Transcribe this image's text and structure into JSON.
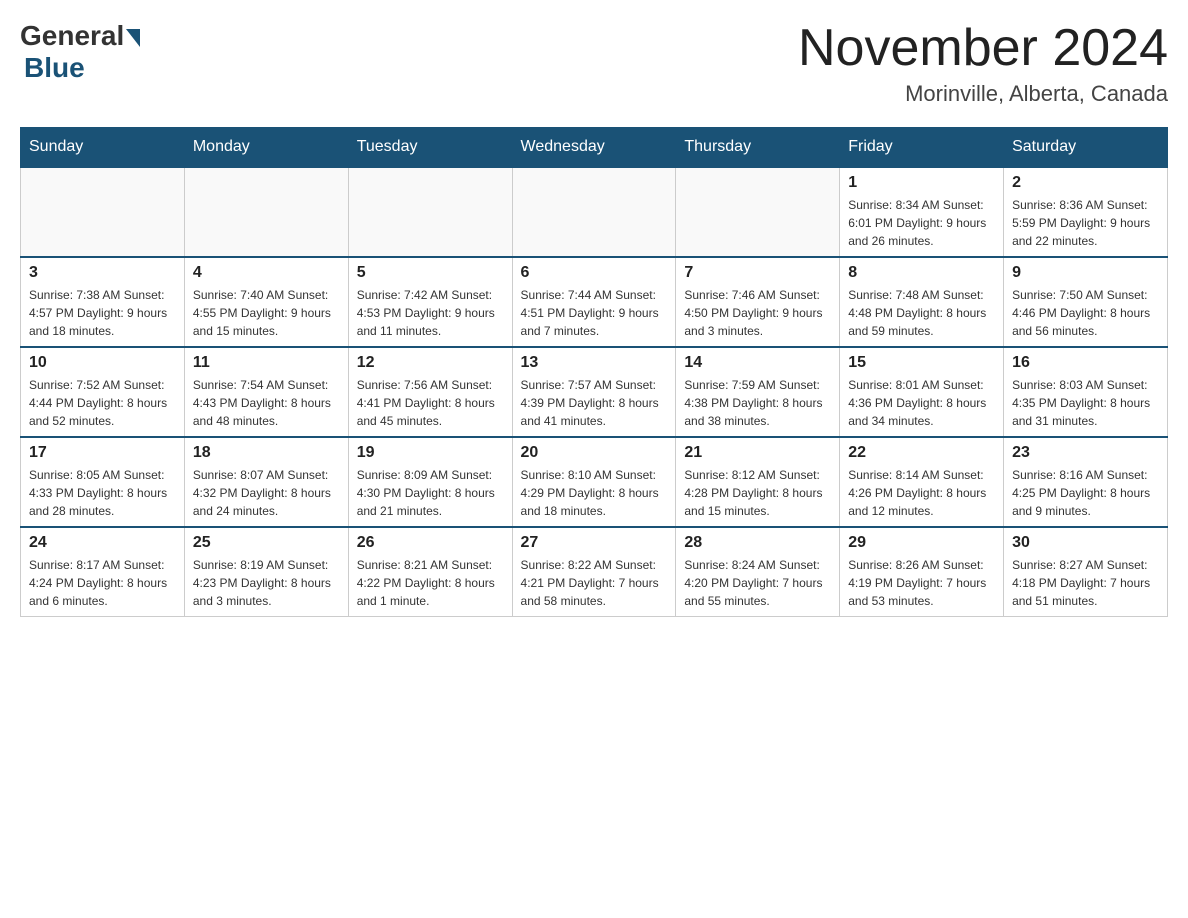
{
  "header": {
    "logo_general": "General",
    "logo_blue": "Blue",
    "main_title": "November 2024",
    "subtitle": "Morinville, Alberta, Canada"
  },
  "days_of_week": [
    "Sunday",
    "Monday",
    "Tuesday",
    "Wednesday",
    "Thursday",
    "Friday",
    "Saturday"
  ],
  "weeks": [
    [
      {
        "day": "",
        "info": ""
      },
      {
        "day": "",
        "info": ""
      },
      {
        "day": "",
        "info": ""
      },
      {
        "day": "",
        "info": ""
      },
      {
        "day": "",
        "info": ""
      },
      {
        "day": "1",
        "info": "Sunrise: 8:34 AM\nSunset: 6:01 PM\nDaylight: 9 hours and 26 minutes."
      },
      {
        "day": "2",
        "info": "Sunrise: 8:36 AM\nSunset: 5:59 PM\nDaylight: 9 hours and 22 minutes."
      }
    ],
    [
      {
        "day": "3",
        "info": "Sunrise: 7:38 AM\nSunset: 4:57 PM\nDaylight: 9 hours and 18 minutes."
      },
      {
        "day": "4",
        "info": "Sunrise: 7:40 AM\nSunset: 4:55 PM\nDaylight: 9 hours and 15 minutes."
      },
      {
        "day": "5",
        "info": "Sunrise: 7:42 AM\nSunset: 4:53 PM\nDaylight: 9 hours and 11 minutes."
      },
      {
        "day": "6",
        "info": "Sunrise: 7:44 AM\nSunset: 4:51 PM\nDaylight: 9 hours and 7 minutes."
      },
      {
        "day": "7",
        "info": "Sunrise: 7:46 AM\nSunset: 4:50 PM\nDaylight: 9 hours and 3 minutes."
      },
      {
        "day": "8",
        "info": "Sunrise: 7:48 AM\nSunset: 4:48 PM\nDaylight: 8 hours and 59 minutes."
      },
      {
        "day": "9",
        "info": "Sunrise: 7:50 AM\nSunset: 4:46 PM\nDaylight: 8 hours and 56 minutes."
      }
    ],
    [
      {
        "day": "10",
        "info": "Sunrise: 7:52 AM\nSunset: 4:44 PM\nDaylight: 8 hours and 52 minutes."
      },
      {
        "day": "11",
        "info": "Sunrise: 7:54 AM\nSunset: 4:43 PM\nDaylight: 8 hours and 48 minutes."
      },
      {
        "day": "12",
        "info": "Sunrise: 7:56 AM\nSunset: 4:41 PM\nDaylight: 8 hours and 45 minutes."
      },
      {
        "day": "13",
        "info": "Sunrise: 7:57 AM\nSunset: 4:39 PM\nDaylight: 8 hours and 41 minutes."
      },
      {
        "day": "14",
        "info": "Sunrise: 7:59 AM\nSunset: 4:38 PM\nDaylight: 8 hours and 38 minutes."
      },
      {
        "day": "15",
        "info": "Sunrise: 8:01 AM\nSunset: 4:36 PM\nDaylight: 8 hours and 34 minutes."
      },
      {
        "day": "16",
        "info": "Sunrise: 8:03 AM\nSunset: 4:35 PM\nDaylight: 8 hours and 31 minutes."
      }
    ],
    [
      {
        "day": "17",
        "info": "Sunrise: 8:05 AM\nSunset: 4:33 PM\nDaylight: 8 hours and 28 minutes."
      },
      {
        "day": "18",
        "info": "Sunrise: 8:07 AM\nSunset: 4:32 PM\nDaylight: 8 hours and 24 minutes."
      },
      {
        "day": "19",
        "info": "Sunrise: 8:09 AM\nSunset: 4:30 PM\nDaylight: 8 hours and 21 minutes."
      },
      {
        "day": "20",
        "info": "Sunrise: 8:10 AM\nSunset: 4:29 PM\nDaylight: 8 hours and 18 minutes."
      },
      {
        "day": "21",
        "info": "Sunrise: 8:12 AM\nSunset: 4:28 PM\nDaylight: 8 hours and 15 minutes."
      },
      {
        "day": "22",
        "info": "Sunrise: 8:14 AM\nSunset: 4:26 PM\nDaylight: 8 hours and 12 minutes."
      },
      {
        "day": "23",
        "info": "Sunrise: 8:16 AM\nSunset: 4:25 PM\nDaylight: 8 hours and 9 minutes."
      }
    ],
    [
      {
        "day": "24",
        "info": "Sunrise: 8:17 AM\nSunset: 4:24 PM\nDaylight: 8 hours and 6 minutes."
      },
      {
        "day": "25",
        "info": "Sunrise: 8:19 AM\nSunset: 4:23 PM\nDaylight: 8 hours and 3 minutes."
      },
      {
        "day": "26",
        "info": "Sunrise: 8:21 AM\nSunset: 4:22 PM\nDaylight: 8 hours and 1 minute."
      },
      {
        "day": "27",
        "info": "Sunrise: 8:22 AM\nSunset: 4:21 PM\nDaylight: 7 hours and 58 minutes."
      },
      {
        "day": "28",
        "info": "Sunrise: 8:24 AM\nSunset: 4:20 PM\nDaylight: 7 hours and 55 minutes."
      },
      {
        "day": "29",
        "info": "Sunrise: 8:26 AM\nSunset: 4:19 PM\nDaylight: 7 hours and 53 minutes."
      },
      {
        "day": "30",
        "info": "Sunrise: 8:27 AM\nSunset: 4:18 PM\nDaylight: 7 hours and 51 minutes."
      }
    ]
  ]
}
